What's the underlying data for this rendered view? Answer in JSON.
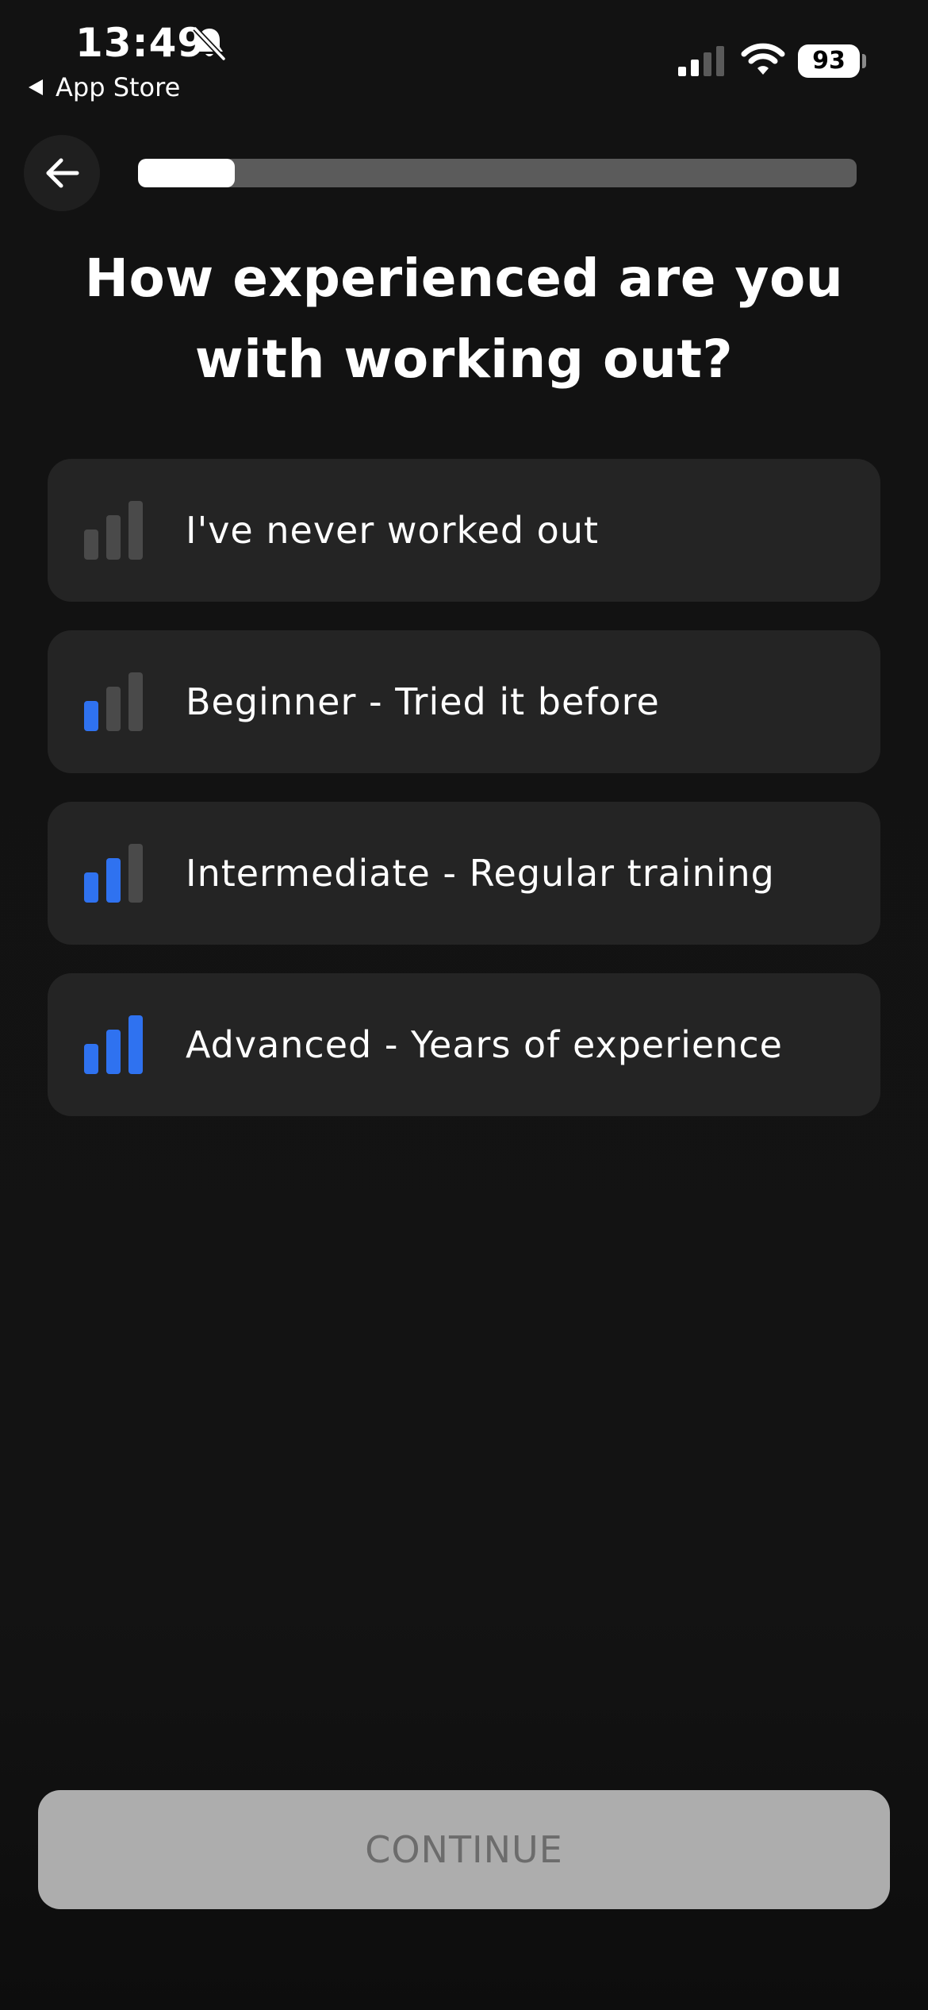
{
  "status_bar": {
    "time": "13:49",
    "back_app_label": "App Store",
    "battery": "93",
    "icons": [
      "bell-slash-icon",
      "cellular-signal-icon",
      "wifi-icon",
      "battery-icon"
    ]
  },
  "nav": {
    "back_icon": "arrow-left-icon",
    "progress_fraction": 0.135
  },
  "title_line1": "How experienced are you",
  "title_line2": "with working out?",
  "options": [
    {
      "label": "I've never worked out",
      "level": 0
    },
    {
      "label": "Beginner - Tried it before",
      "level": 1
    },
    {
      "label": "Intermediate - Regular training",
      "level": 2
    },
    {
      "label": "Advanced - Years of experience",
      "level": 3
    }
  ],
  "continue_label": "CONTINUE",
  "colors": {
    "background": "#121212",
    "card": "#242424",
    "accent_blue": "#2f72f0",
    "inactive_bar": "#4a4a4a",
    "button_disabled_bg": "#adadad",
    "button_disabled_text": "#6c6c6c"
  }
}
